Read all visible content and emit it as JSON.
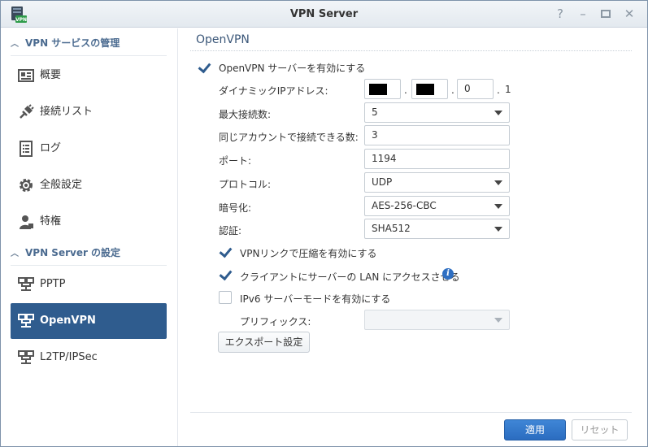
{
  "window": {
    "title": "VPN Server"
  },
  "titlebar_buttons": [
    "help-icon",
    "minimize-icon",
    "maximize-icon",
    "close-icon"
  ],
  "sidebar": {
    "section1": {
      "label": "VPN サービスの管理"
    },
    "section2": {
      "label": "VPN Server の設定"
    },
    "items": [
      {
        "label": "概要",
        "icon": "overview-icon"
      },
      {
        "label": "接続リスト",
        "icon": "plug-icon"
      },
      {
        "label": "ログ",
        "icon": "log-icon"
      },
      {
        "label": "全般設定",
        "icon": "gear-icon"
      },
      {
        "label": "特権",
        "icon": "user-icon"
      },
      {
        "label": "PPTP",
        "icon": "network-icon"
      },
      {
        "label": "OpenVPN",
        "icon": "network-icon",
        "active": true
      },
      {
        "label": "L2TP/IPSec",
        "icon": "network-icon"
      }
    ]
  },
  "panel": {
    "title": "OpenVPN",
    "enable": {
      "label": "OpenVPN サーバーを有効にする",
      "checked": true
    },
    "dynamic_ip": {
      "label": "ダイナミックIPアドレス:",
      "oct3": "0",
      "oct4": "1"
    },
    "max_conn": {
      "label": "最大接続数:",
      "value": "5"
    },
    "same_account": {
      "label": "同じアカウントで接続できる数:",
      "value": "3"
    },
    "port": {
      "label": "ポート:",
      "value": "1194"
    },
    "protocol": {
      "label": "プロトコル:",
      "value": "UDP"
    },
    "encryption": {
      "label": "暗号化:",
      "value": "AES-256-CBC"
    },
    "auth": {
      "label": "認証:",
      "value": "SHA512"
    },
    "compress": {
      "label": "VPNリンクで圧縮を有効にする",
      "checked": true
    },
    "lan_access": {
      "label": "クライアントにサーバーの LAN にアクセスさせる",
      "checked": true,
      "info": "i"
    },
    "ipv6": {
      "label": "IPv6 サーバーモードを有効にする",
      "checked": false
    },
    "prefix": {
      "label": "プリフィックス:",
      "value": ""
    },
    "export_label": "エクスポート設定"
  },
  "footer": {
    "apply_label": "適用",
    "reset_label": "リセット"
  },
  "colors": {
    "accent": "#2f5c8e",
    "primary_button": "#2b6cc0",
    "section_header": "#4b6b90"
  }
}
